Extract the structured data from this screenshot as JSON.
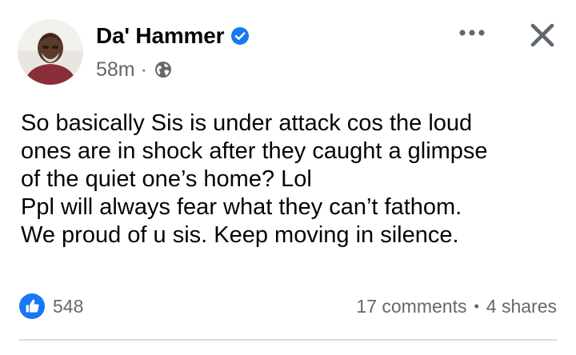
{
  "post": {
    "author_name": "Da' Hammer",
    "verified": true,
    "timestamp": "58m",
    "separator": "·",
    "audience_icon": "globe-icon",
    "text_lines": [
      "So basically Sis is under attack cos the loud",
      "ones are in shock after they caught a glimpse",
      "of the quiet one’s home? Lol",
      "Ppl will always fear what they can’t fathom.",
      "We proud of u sis. Keep moving in silence."
    ]
  },
  "header_actions": {
    "more_icon": "more-options-icon",
    "close_icon": "close-icon"
  },
  "footer": {
    "reaction_icon": "like-icon",
    "like_count": "548",
    "comments": "17 comments",
    "dot": "•",
    "shares": "4 shares"
  },
  "colors": {
    "brand_blue": "#1877f2",
    "text_primary": "#050505",
    "text_secondary": "#65676b",
    "icon_gray": "#606770",
    "divider": "#dadde1"
  }
}
